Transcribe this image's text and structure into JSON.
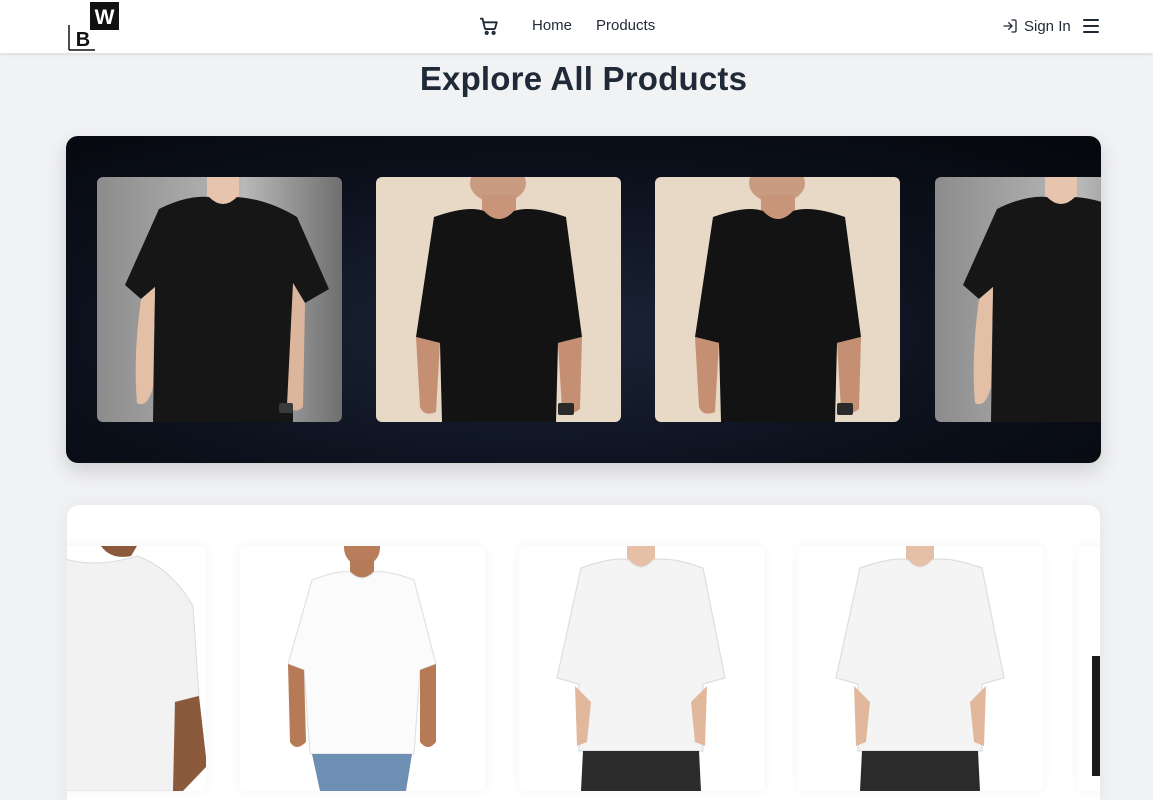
{
  "brand": {
    "logo_letter_main": "B",
    "logo_letter_corner": "W"
  },
  "nav": {
    "cart_icon": "shopping-cart-icon",
    "home_label": "Home",
    "products_label": "Products",
    "signin_icon": "log-in-icon",
    "signin_label": "Sign In",
    "menu_icon": "hamburger-menu-icon"
  },
  "page": {
    "title": "Explore All Products"
  },
  "featured_carousel": {
    "background": "#0c111d",
    "items": [
      {
        "image": "black-tshirt-model-grey-background"
      },
      {
        "image": "black-oversized-tshirt-model-beige-background"
      },
      {
        "image": "black-oversized-tshirt-model-beige-background"
      },
      {
        "image": "black-tshirt-model-grey-background"
      }
    ]
  },
  "white_carousel": {
    "items": [
      {
        "image": "white-tshirt-model-cropped"
      },
      {
        "image": "white-tshirt-model-smiling-jeans"
      },
      {
        "image": "white-oversized-tshirt-model-black-pants"
      },
      {
        "image": "white-oversized-tshirt-model-black-pants"
      },
      {
        "image": "white-product-card-partial"
      }
    ]
  }
}
